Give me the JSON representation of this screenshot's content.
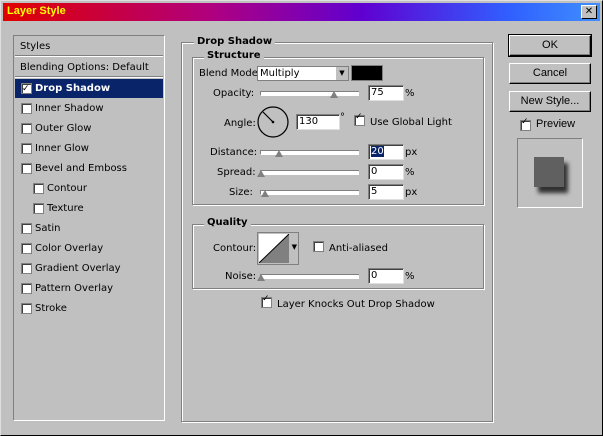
{
  "window": {
    "title": "Layer Style",
    "close_glyph": "✕"
  },
  "sidebar": {
    "header": "Styles",
    "blending": "Blending Options: Default",
    "items": [
      {
        "label": "Drop Shadow",
        "checked": true,
        "selected": true
      },
      {
        "label": "Inner Shadow",
        "checked": false
      },
      {
        "label": "Outer Glow",
        "checked": false
      },
      {
        "label": "Inner Glow",
        "checked": false
      },
      {
        "label": "Bevel and Emboss",
        "checked": false
      },
      {
        "label": "Contour",
        "checked": false
      },
      {
        "label": "Texture",
        "checked": false
      },
      {
        "label": "Satin",
        "checked": false
      },
      {
        "label": "Color Overlay",
        "checked": false
      },
      {
        "label": "Gradient Overlay",
        "checked": false
      },
      {
        "label": "Pattern Overlay",
        "checked": false
      },
      {
        "label": "Stroke",
        "checked": false
      }
    ]
  },
  "main": {
    "title": "Drop Shadow",
    "structure": {
      "title": "Structure",
      "blend_mode_label": "Blend Mode:",
      "blend_mode_value": "Multiply",
      "shadow_color": "#000000",
      "opacity_label": "Opacity:",
      "opacity_value": "75",
      "opacity_unit": "%",
      "angle_label": "Angle:",
      "angle_value": "130",
      "angle_unit": "°",
      "use_global_light_label": "Use Global Light",
      "use_global_light": true,
      "distance_label": "Distance:",
      "distance_value": "20",
      "distance_unit": "px",
      "spread_label": "Spread:",
      "spread_value": "0",
      "spread_unit": "%",
      "size_label": "Size:",
      "size_value": "5",
      "size_unit": "px"
    },
    "quality": {
      "title": "Quality",
      "contour_label": "Contour:",
      "anti_aliased_label": "Anti-aliased",
      "anti_aliased": false,
      "noise_label": "Noise:",
      "noise_value": "0",
      "noise_unit": "%"
    },
    "knocks_out_label": "Layer Knocks Out Drop Shadow",
    "knocks_out": true
  },
  "buttons": {
    "ok": "OK",
    "cancel": "Cancel",
    "new_style": "New Style..."
  },
  "preview": {
    "label": "Preview",
    "checked": true
  }
}
